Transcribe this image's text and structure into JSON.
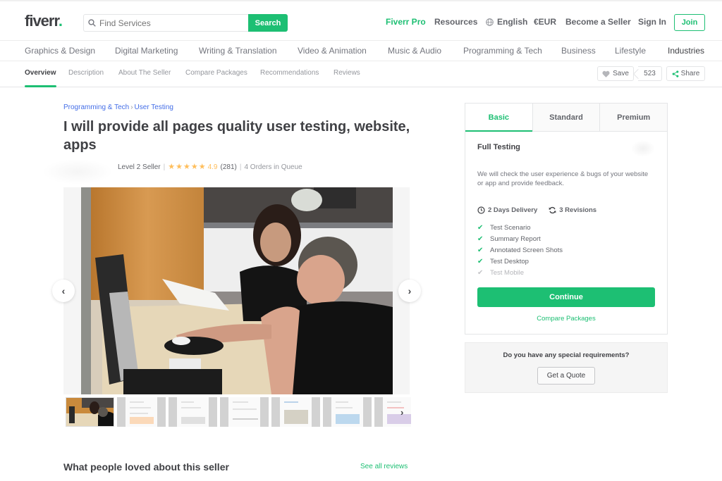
{
  "header": {
    "logo": "fiverr",
    "logo_dot": ".",
    "search_placeholder": "Find Services",
    "search_button": "Search",
    "nav": {
      "pro": "Fiverr Pro",
      "resources": "Resources",
      "language": "English",
      "currency": "€EUR",
      "become_seller": "Become a Seller",
      "sign_in": "Sign In",
      "join": "Join"
    },
    "colors": {
      "brand_green": "#1dbf73",
      "text_dark": "#404145"
    }
  },
  "categories": [
    "Graphics & Design",
    "Digital Marketing",
    "Writing & Translation",
    "Video & Animation",
    "Music & Audio",
    "Programming & Tech",
    "Business",
    "Lifestyle",
    "Industries"
  ],
  "subnav": {
    "items": [
      "Overview",
      "Description",
      "About The Seller",
      "Compare Packages",
      "Recommendations",
      "Reviews"
    ],
    "active": "Overview",
    "save_label": "Save",
    "save_count": "523",
    "share_label": "Share"
  },
  "gig": {
    "breadcrumb": [
      "Programming & Tech",
      "User Testing"
    ],
    "breadcrumb_sep": "›",
    "title": "I will provide all pages quality user testing, website, apps",
    "seller_level": "Level 2 Seller",
    "stars": 5,
    "rating": "4.9",
    "review_count": "(281)",
    "orders_in_queue": "4 Orders in Queue",
    "gallery_prev": "‹",
    "gallery_next": "›",
    "thumb_next": "›",
    "thumbnail_count": 7,
    "active_thumbnail": 1
  },
  "package": {
    "tabs": [
      "Basic",
      "Standard",
      "Premium"
    ],
    "active_tab": "Basic",
    "name": "Full Testing",
    "description": "We will check the user experience & bugs of your website or app and provide feedback.",
    "delivery": "2 Days Delivery",
    "revisions": "3 Revisions",
    "features": [
      {
        "label": "Test Scenario",
        "included": true
      },
      {
        "label": "Summary Report",
        "included": true
      },
      {
        "label": "Annotated Screen Shots",
        "included": true
      },
      {
        "label": "Test Desktop",
        "included": true
      },
      {
        "label": "Test Mobile",
        "included": false
      }
    ],
    "continue_label": "Continue",
    "compare_label": "Compare Packages"
  },
  "quote": {
    "question": "Do you have any special requirements?",
    "button": "Get a Quote"
  },
  "reviews_section": {
    "title": "What people loved about this seller",
    "see_all": "See all reviews"
  }
}
